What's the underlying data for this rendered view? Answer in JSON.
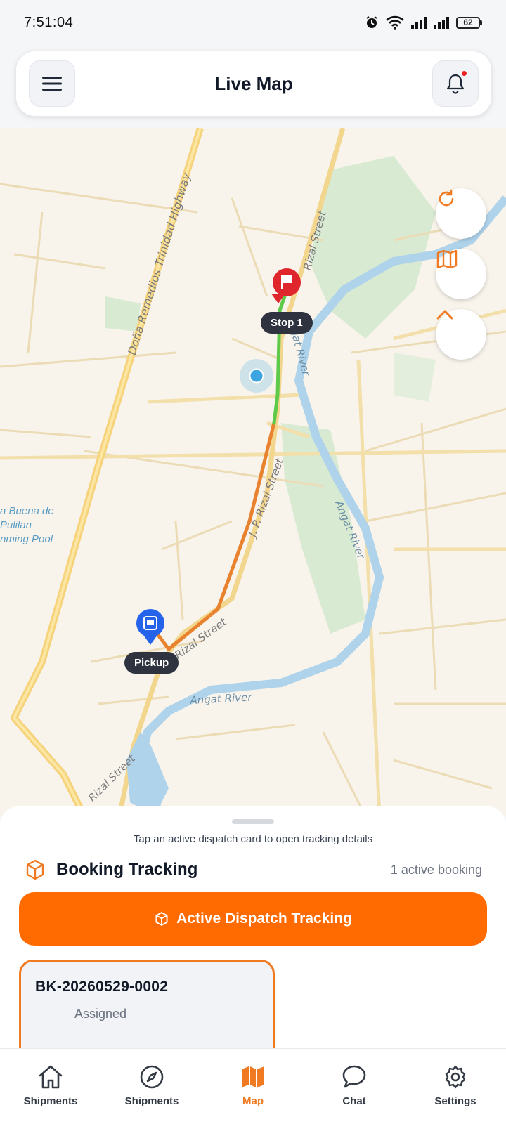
{
  "status_bar": {
    "time": "7:51:04",
    "battery": "62"
  },
  "header": {
    "title": "Live Map",
    "menu_icon": "hamburger-menu-icon",
    "notification_icon": "bell-icon"
  },
  "map": {
    "road_labels": [
      "Doña Remedios Trinidad Highway",
      "Rizal Street",
      "J. P. Rizal Street",
      "Rizal Street",
      "Rizal Street"
    ],
    "river_labels": [
      "Angat River",
      "Angat River",
      "Angat River"
    ],
    "pool_label_lines": [
      "a Buena de",
      "Pulilan",
      "nming Pool"
    ],
    "stop_label": "Stop 1",
    "pickup_label": "Pickup",
    "controls": [
      {
        "name": "refresh",
        "icon": "refresh-icon"
      },
      {
        "name": "map-layers",
        "icon": "map-icon"
      },
      {
        "name": "expand",
        "icon": "chevron-up-icon"
      }
    ],
    "colors": {
      "route_completed": "#e8822e",
      "route_remaining": "#5fc94a",
      "stop_pin": "#e0262d",
      "pickup_pin": "#2563eb",
      "current_location": "#3aa5e0"
    }
  },
  "sheet": {
    "hint": "Tap an active dispatch card to open tracking details",
    "title": "Booking Tracking",
    "count": "1 active booking",
    "dispatch_button": "Active Dispatch Tracking",
    "booking": {
      "id": "BK-20260529-0002",
      "status": "Assigned"
    }
  },
  "bottom_nav": {
    "items": [
      {
        "label": "Shipments",
        "icon": "home-icon"
      },
      {
        "label": "Shipments",
        "icon": "compass-icon"
      },
      {
        "label": "Map",
        "icon": "map-icon",
        "active": true
      },
      {
        "label": "Chat",
        "icon": "chat-bubble-icon"
      },
      {
        "label": "Settings",
        "icon": "gear-icon"
      }
    ],
    "accent": "#f07a21"
  }
}
